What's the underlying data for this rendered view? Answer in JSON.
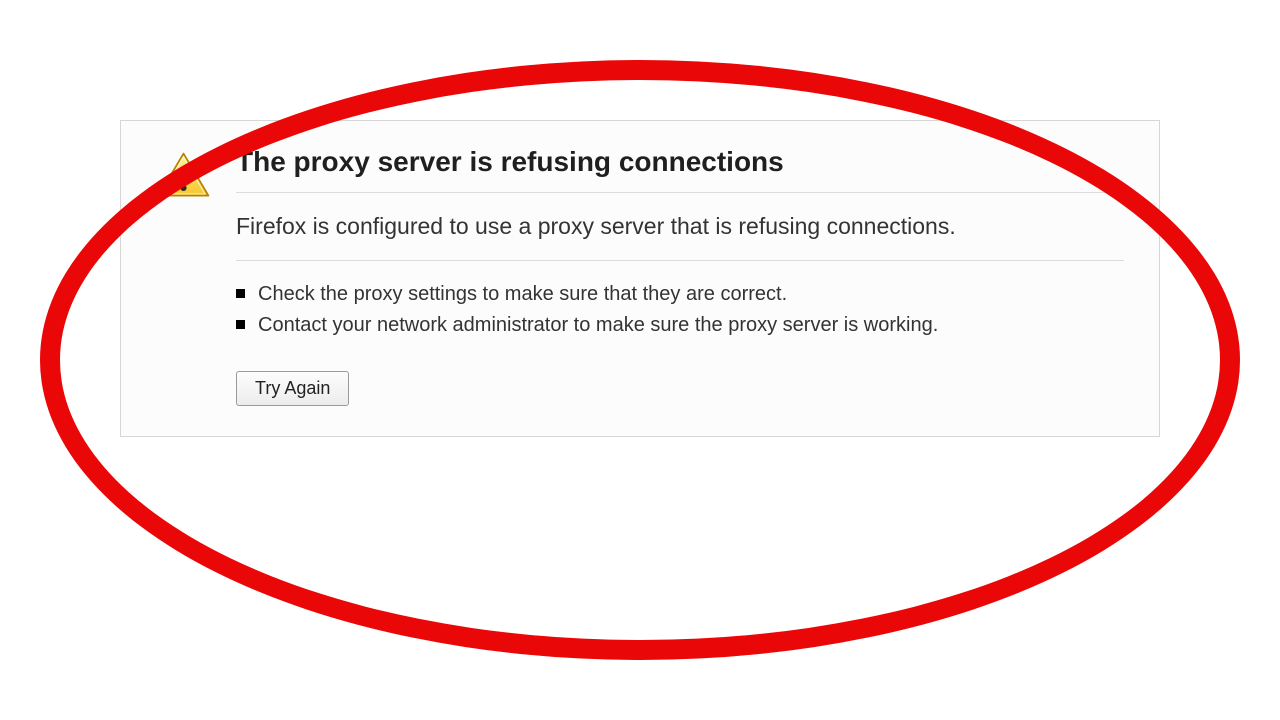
{
  "error": {
    "title": "The proxy server is refusing connections",
    "subtitle": "Firefox is configured to use a proxy server that is refusing connections.",
    "tips": [
      "Check the proxy settings to make sure that they are correct.",
      "Contact your network administrator to make sure the proxy server is working."
    ],
    "retry_label": "Try Again"
  },
  "icon_name": "warning-icon",
  "highlight_color": "#ea0707"
}
